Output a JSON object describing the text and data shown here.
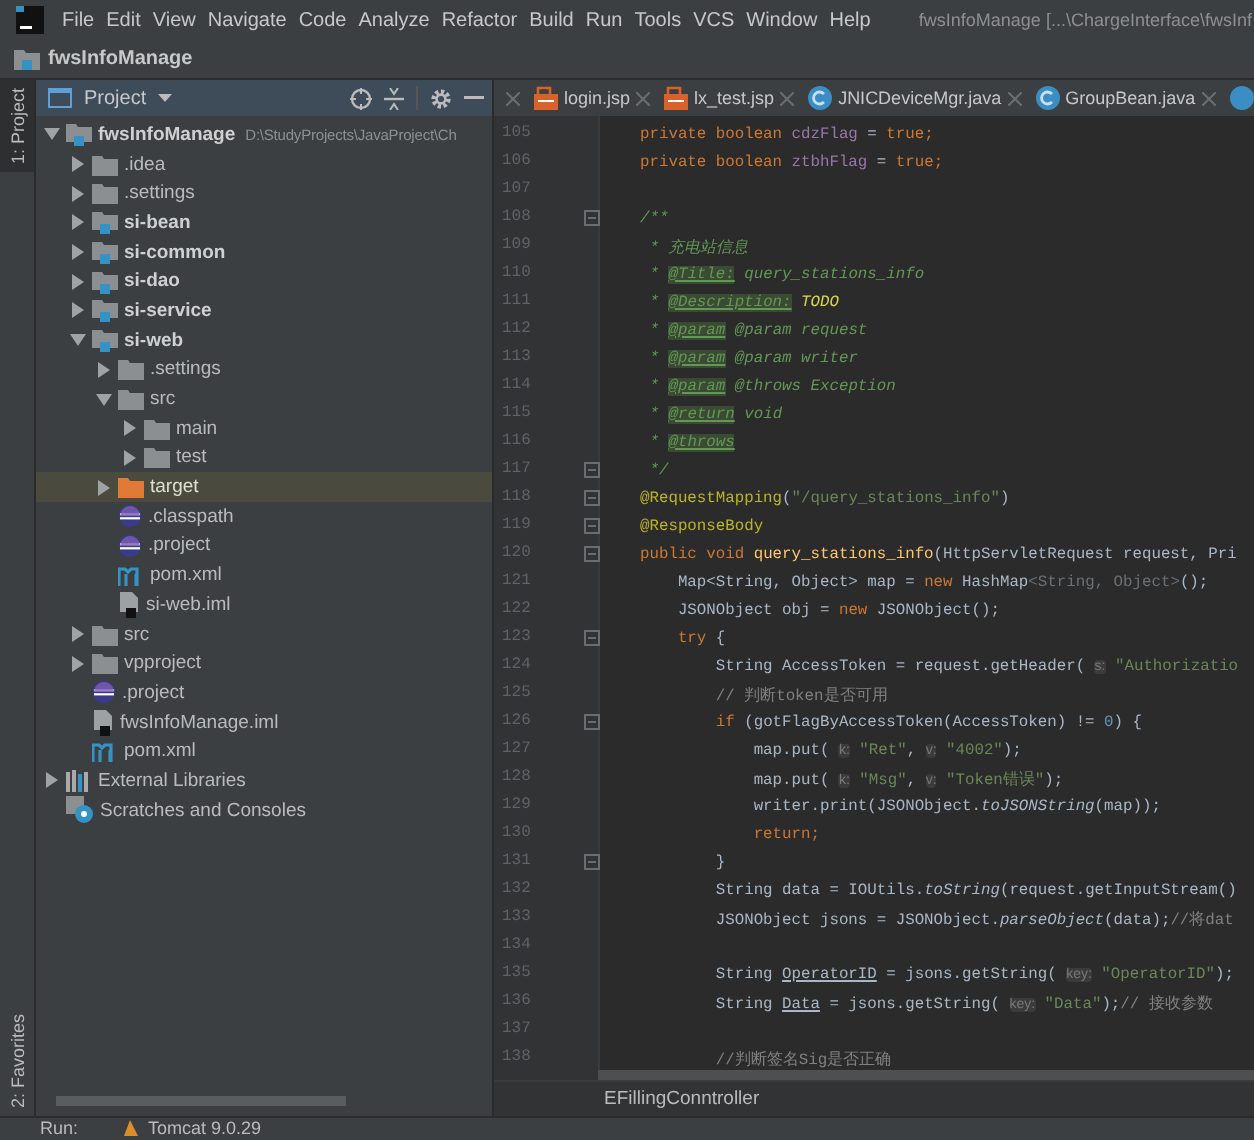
{
  "window": {
    "title": "fwsInfoManage [...\\ChargeInterface\\fwsInf"
  },
  "menu": [
    "File",
    "Edit",
    "View",
    "Navigate",
    "Code",
    "Analyze",
    "Refactor",
    "Build",
    "Run",
    "Tools",
    "VCS",
    "Window",
    "Help"
  ],
  "navigation_bar": {
    "project": "fwsInfoManage"
  },
  "left_strip": [
    "1: Project",
    "2: Favorites"
  ],
  "project_panel": {
    "title": "Project",
    "tree": [
      {
        "label": "fwsInfoManage",
        "kind": "module",
        "path": "D:\\StudyProjects\\JavaProject\\Ch",
        "expanded": true,
        "selected": false,
        "children": [
          {
            "label": ".idea",
            "kind": "folder",
            "expanded": false,
            "selected": false
          },
          {
            "label": ".settings",
            "kind": "folder",
            "expanded": false,
            "selected": false
          },
          {
            "label": "si-bean",
            "kind": "module",
            "expanded": false,
            "selected": false
          },
          {
            "label": "si-common",
            "kind": "module",
            "expanded": false,
            "selected": false
          },
          {
            "label": "si-dao",
            "kind": "module",
            "expanded": false,
            "selected": false
          },
          {
            "label": "si-service",
            "kind": "module",
            "expanded": false,
            "selected": false
          },
          {
            "label": "si-web",
            "kind": "module",
            "expanded": true,
            "selected": false,
            "children": [
              {
                "label": ".settings",
                "kind": "folder",
                "expanded": false,
                "selected": false
              },
              {
                "label": "src",
                "kind": "folder",
                "expanded": true,
                "selected": false,
                "children": [
                  {
                    "label": "main",
                    "kind": "folder",
                    "expanded": false,
                    "selected": false
                  },
                  {
                    "label": "test",
                    "kind": "folder",
                    "expanded": false,
                    "selected": false
                  }
                ]
              },
              {
                "label": "target",
                "kind": "excluded",
                "expanded": false,
                "selected": true
              },
              {
                "label": ".classpath",
                "kind": "eclipse",
                "selected": false
              },
              {
                "label": ".project",
                "kind": "eclipse",
                "selected": false
              },
              {
                "label": "pom.xml",
                "kind": "maven",
                "selected": false
              },
              {
                "label": "si-web.iml",
                "kind": "iml",
                "selected": false
              }
            ]
          },
          {
            "label": "src",
            "kind": "folder",
            "expanded": false,
            "selected": false
          },
          {
            "label": "vpproject",
            "kind": "folder",
            "expanded": false,
            "selected": false
          },
          {
            "label": ".project",
            "kind": "eclipse",
            "selected": false
          },
          {
            "label": "fwsInfoManage.iml",
            "kind": "iml",
            "selected": false
          },
          {
            "label": "pom.xml",
            "kind": "maven",
            "selected": false
          }
        ]
      },
      {
        "label": "External Libraries",
        "kind": "libraries",
        "expanded": false,
        "selected": false
      },
      {
        "label": "Scratches and Consoles",
        "kind": "scratches",
        "selected": false
      }
    ]
  },
  "tabs": [
    {
      "label": "login.jsp",
      "kind": "jsp"
    },
    {
      "label": "lx_test.jsp",
      "kind": "jsp"
    },
    {
      "label": "JNICDeviceMgr.java",
      "kind": "class"
    },
    {
      "label": "GroupBean.java",
      "kind": "class"
    }
  ],
  "editor": {
    "lines": [
      {
        "n": "105",
        "fold": false,
        "tokens": [
          {
            "kind": "kw",
            "text": "private boolean "
          },
          {
            "kind": "field",
            "text": "cdzFlag"
          },
          {
            "kind": "plain",
            "text": " = "
          },
          {
            "kind": "kw",
            "text": "true;"
          }
        ]
      },
      {
        "n": "106",
        "fold": false,
        "tokens": [
          {
            "kind": "kw",
            "text": "private boolean "
          },
          {
            "kind": "field",
            "text": "ztbhFlag"
          },
          {
            "kind": "plain",
            "text": " = "
          },
          {
            "kind": "kw",
            "text": "true;"
          }
        ]
      },
      {
        "n": "107",
        "fold": false
      },
      {
        "n": "108",
        "fold": true,
        "tokens": [
          {
            "kind": "doc",
            "text": "/**"
          }
        ]
      },
      {
        "n": "109",
        "fold": false,
        "tokens": [
          {
            "kind": "doc",
            "text": " * 充电站信息"
          }
        ]
      },
      {
        "n": "110",
        "fold": false,
        "tokens": [
          {
            "kind": "doc",
            "text": " * "
          },
          {
            "kind": "doctag",
            "text": "@Title:"
          },
          {
            "kind": "doc",
            "text": " query_stations_info"
          }
        ]
      },
      {
        "n": "111",
        "fold": false,
        "tokens": [
          {
            "kind": "doc",
            "text": " * "
          },
          {
            "kind": "doctag",
            "text": "@Description:"
          },
          {
            "kind": "todo",
            "text": " TODO"
          }
        ]
      },
      {
        "n": "112",
        "fold": false,
        "tokens": [
          {
            "kind": "doc",
            "text": " * "
          },
          {
            "kind": "doctag",
            "text": "@param"
          },
          {
            "kind": "doc",
            "text": " @param request"
          }
        ]
      },
      {
        "n": "113",
        "fold": false,
        "tokens": [
          {
            "kind": "doc",
            "text": " * "
          },
          {
            "kind": "doctag",
            "text": "@param"
          },
          {
            "kind": "doc",
            "text": " @param writer"
          }
        ]
      },
      {
        "n": "114",
        "fold": false,
        "tokens": [
          {
            "kind": "doc",
            "text": " * "
          },
          {
            "kind": "doctag",
            "text": "@param"
          },
          {
            "kind": "doc",
            "text": " @throws Exception"
          }
        ]
      },
      {
        "n": "115",
        "fold": false,
        "tokens": [
          {
            "kind": "doc",
            "text": " * "
          },
          {
            "kind": "doctag",
            "text": "@return"
          },
          {
            "kind": "doc",
            "text": " void"
          }
        ]
      },
      {
        "n": "116",
        "fold": false,
        "tokens": [
          {
            "kind": "doc",
            "text": " * "
          },
          {
            "kind": "doctag",
            "text": "@throws"
          }
        ]
      },
      {
        "n": "117",
        "fold": true,
        "tokens": [
          {
            "kind": "doc",
            "text": " */"
          }
        ]
      },
      {
        "n": "118",
        "fold": true,
        "tokens": [
          {
            "kind": "ann",
            "text": "@RequestMapping"
          },
          {
            "kind": "plain",
            "text": "("
          },
          {
            "kind": "str",
            "text": "\"/query_stations_info\""
          },
          {
            "kind": "plain",
            "text": ")"
          }
        ]
      },
      {
        "n": "119",
        "fold": true,
        "tokens": [
          {
            "kind": "ann",
            "text": "@ResponseBody"
          }
        ]
      },
      {
        "n": "120",
        "fold": true,
        "tokens": [
          {
            "kind": "kw",
            "text": "public void "
          },
          {
            "kind": "fn",
            "text": "query_stations_info"
          },
          {
            "kind": "plain",
            "text": "(HttpServletRequest request, Pri"
          }
        ]
      },
      {
        "n": "121",
        "fold": false,
        "tokens": [
          {
            "kind": "plain",
            "text": "    Map<String, Object> map = "
          },
          {
            "kind": "kw",
            "text": "new "
          },
          {
            "kind": "plain",
            "text": "HashMap"
          },
          {
            "kind": "muted",
            "text": "<String, Object>"
          },
          {
            "kind": "plain",
            "text": "();"
          }
        ]
      },
      {
        "n": "122",
        "fold": false,
        "tokens": [
          {
            "kind": "plain",
            "text": "    JSONObject obj = "
          },
          {
            "kind": "kw",
            "text": "new "
          },
          {
            "kind": "plain",
            "text": "JSONObject();"
          }
        ]
      },
      {
        "n": "123",
        "fold": true,
        "tokens": [
          {
            "kind": "kw",
            "text": "    try "
          },
          {
            "kind": "plain",
            "text": "{"
          }
        ]
      },
      {
        "n": "124",
        "fold": false,
        "tokens": [
          {
            "kind": "plain",
            "text": "        String AccessToken = request.getHeader( "
          },
          {
            "kind": "hint",
            "text": "s:"
          },
          {
            "kind": "str",
            "text": " \"Authorizatio"
          }
        ]
      },
      {
        "n": "125",
        "fold": false,
        "tokens": [
          {
            "kind": "comment",
            "text": "        // 判断token是否可用"
          }
        ]
      },
      {
        "n": "126",
        "fold": true,
        "tokens": [
          {
            "kind": "kw",
            "text": "        if "
          },
          {
            "kind": "plain",
            "text": "(gotFlagByAccessToken(AccessToken) != "
          },
          {
            "kind": "num",
            "text": "0"
          },
          {
            "kind": "plain",
            "text": ") {"
          }
        ]
      },
      {
        "n": "127",
        "fold": false,
        "tokens": [
          {
            "kind": "plain",
            "text": "            map.put( "
          },
          {
            "kind": "hint",
            "text": "k:"
          },
          {
            "kind": "str",
            "text": " \"Ret\""
          },
          {
            "kind": "plain",
            "text": ", "
          },
          {
            "kind": "hint",
            "text": "v:"
          },
          {
            "kind": "str",
            "text": " \"4002\""
          },
          {
            "kind": "plain",
            "text": ");"
          }
        ]
      },
      {
        "n": "128",
        "fold": false,
        "tokens": [
          {
            "kind": "plain",
            "text": "            map.put( "
          },
          {
            "kind": "hint",
            "text": "k:"
          },
          {
            "kind": "str",
            "text": " \"Msg\""
          },
          {
            "kind": "plain",
            "text": ", "
          },
          {
            "kind": "hint",
            "text": "v:"
          },
          {
            "kind": "str",
            "text": " \"Token错误\""
          },
          {
            "kind": "plain",
            "text": ");"
          }
        ]
      },
      {
        "n": "129",
        "fold": false,
        "tokens": [
          {
            "kind": "plain",
            "text": "            writer.print(JSONObject."
          },
          {
            "kind": "static",
            "text": "toJSONString"
          },
          {
            "kind": "plain",
            "text": "(map));"
          }
        ]
      },
      {
        "n": "130",
        "fold": false,
        "tokens": [
          {
            "kind": "kw",
            "text": "            return;"
          }
        ]
      },
      {
        "n": "131",
        "fold": true,
        "tokens": [
          {
            "kind": "plain",
            "text": "        }"
          }
        ]
      },
      {
        "n": "132",
        "fold": false,
        "tokens": [
          {
            "kind": "plain",
            "text": "        String data = IOUtils."
          },
          {
            "kind": "static",
            "text": "toString"
          },
          {
            "kind": "plain",
            "text": "(request.getInputStream()"
          }
        ]
      },
      {
        "n": "133",
        "fold": false,
        "tokens": [
          {
            "kind": "plain",
            "text": "        JSONObject jsons = JSONObject."
          },
          {
            "kind": "static",
            "text": "parseObject"
          },
          {
            "kind": "plain",
            "text": "(data);"
          },
          {
            "kind": "comment",
            "text": "//将dat"
          }
        ]
      },
      {
        "n": "134",
        "fold": false
      },
      {
        "n": "135",
        "fold": false,
        "tokens": [
          {
            "kind": "plain",
            "text": "        String "
          },
          {
            "kind": "underline",
            "text": "OperatorID"
          },
          {
            "kind": "plain",
            "text": " = jsons.getString( "
          },
          {
            "kind": "hint",
            "text": "key:"
          },
          {
            "kind": "str",
            "text": " \"OperatorID\""
          },
          {
            "kind": "plain",
            "text": ");"
          }
        ]
      },
      {
        "n": "136",
        "fold": false,
        "tokens": [
          {
            "kind": "plain",
            "text": "        String "
          },
          {
            "kind": "underline",
            "text": "Data"
          },
          {
            "kind": "plain",
            "text": " = jsons.getString( "
          },
          {
            "kind": "hint",
            "text": "key:"
          },
          {
            "kind": "str",
            "text": " \"Data\""
          },
          {
            "kind": "plain",
            "text": ");"
          },
          {
            "kind": "comment",
            "text": "// 接收参数"
          }
        ]
      },
      {
        "n": "137",
        "fold": false
      },
      {
        "n": "138",
        "fold": false,
        "tokens": [
          {
            "kind": "comment",
            "text": "        //判断签名Sig是否正确"
          }
        ]
      }
    ],
    "breadcrumb": "EFillingConntroller"
  },
  "run_bar": {
    "label": "Run:",
    "config": "Tomcat 9.0.29"
  }
}
